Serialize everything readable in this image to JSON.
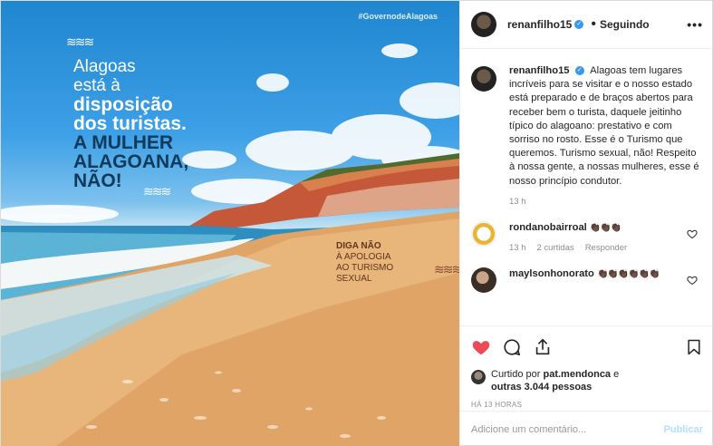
{
  "image": {
    "gov_tag": "#GovernodeAlagoas",
    "headline": [
      "Alagoas",
      "está à",
      "disposição",
      "dos turistas.",
      "A MULHER",
      "ALAGOANA,",
      "NÃO!"
    ],
    "diga": [
      "DIGA NÃO",
      "À APOLOGIA",
      "AO TURISMO",
      "SEXUAL"
    ]
  },
  "header": {
    "username": "renanfilho15",
    "dot": "•",
    "follow_status": "Seguindo",
    "more": "•••"
  },
  "caption": {
    "username": "renanfilho15",
    "text": "Alagoas tem lugares incríveis para se visitar e o nosso estado está preparado e de braços abertos para receber bem o turista, daquele jeitinho típico do alagoano: prestativo e com sorriso no rosto. Esse é o Turismo que queremos. Turismo sexual, não! Respeito à nossa gente, a nossas mulheres, esse é nosso princípio condutor.",
    "time": "13 h"
  },
  "comments": [
    {
      "username": "rondanobairroal",
      "emoji": "👏🏿👏🏿👏🏿",
      "time": "13 h",
      "likes": "2 curtidas",
      "reply": "Responder"
    },
    {
      "username": "maylsonhonorato",
      "emoji": "👏🏿👏🏿👏🏿👏🏿👏🏿👏🏿"
    }
  ],
  "likes": {
    "prefix": "Curtido por",
    "user": "pat.mendonca",
    "suffix": "e",
    "others": "outras 3.044 pessoas"
  },
  "timestamp": "HÁ 13 HORAS",
  "add_comment": {
    "placeholder": "Adicione um comentário...",
    "button": "Publicar"
  },
  "colors": {
    "like_red": "#ed4956",
    "verified_blue": "#3897f0",
    "publish_disabled": "#b2dffc"
  }
}
